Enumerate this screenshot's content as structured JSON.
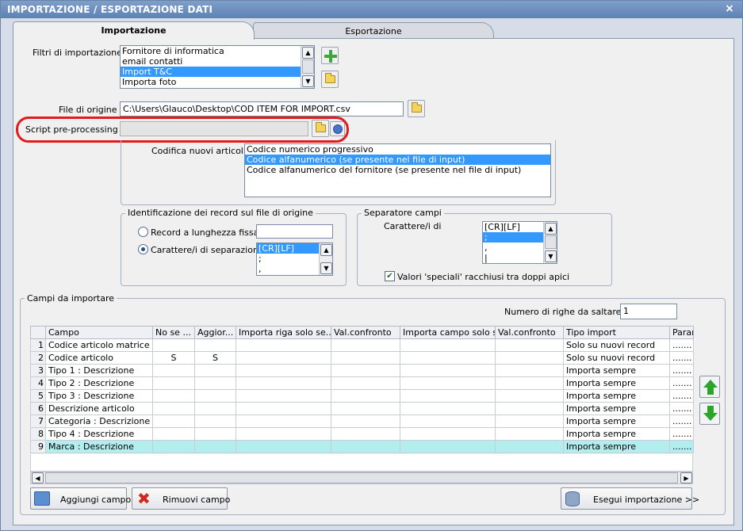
{
  "window": {
    "title": "IMPORTAZIONE / ESPORTAZIONE DATI",
    "close_glyph": "×"
  },
  "tabs": [
    {
      "label": "Importazione"
    },
    {
      "label": "Esportazione"
    }
  ],
  "filters": {
    "label": "Filtri di importazione :",
    "items": [
      "Fornitore di informatica",
      "email contatti",
      "Import T&C",
      "Importa foto"
    ],
    "selected_index": 2
  },
  "source_file": {
    "label": "File di origine :",
    "value": "C:\\Users\\Glauco\\Desktop\\COD ITEM FOR IMPORT.csv"
  },
  "script": {
    "label": "Script pre-processing :",
    "value": ""
  },
  "codifica": {
    "label": "Codifica nuovi articoli :",
    "items": [
      "Codice numerico progressivo",
      "Codice alfanumerico (se presente nel file di input)",
      "Codice alfanumerico del fornitore (se presente nel file di input)"
    ],
    "selected_index": 1
  },
  "identification": {
    "title": "Identificazione dei record sul file di origine",
    "fixed_label": "Record a lunghezza fissa",
    "fixed_value": "",
    "sep_label": "Carattere/i di separazione",
    "sep_items": [
      "[CR][LF]",
      ";",
      ","
    ]
  },
  "separator": {
    "title": "Separatore campi",
    "chars_label": "Carattere/i di",
    "items": [
      "[CR][LF]",
      ";",
      ",",
      "|"
    ],
    "quotes_label": "Valori 'speciali' racchiusi tra doppi apici",
    "quotes_checked": "✔"
  },
  "fields": {
    "title": "Campi da importare",
    "skip_label": "Numero di righe da saltare :",
    "skip_value": "1",
    "columns": [
      "Campo",
      "No se ...",
      "Aggior...",
      "Importa riga solo se...",
      "Val.confronto",
      "Importa campo solo s...",
      "Val.confronto",
      "Tipo import",
      "Paran"
    ],
    "rows": [
      {
        "n": "1",
        "campo": "Codice articolo matrice",
        "no_se": "",
        "aggior": "",
        "tipo": "Solo su nuovi record",
        "param": "......."
      },
      {
        "n": "2",
        "campo": "Codice articolo",
        "no_se": "S",
        "aggior": "S",
        "tipo": "Solo su nuovi record",
        "param": "......."
      },
      {
        "n": "3",
        "campo": "Tipo 1 : Descrizione",
        "no_se": "",
        "aggior": "",
        "tipo": "Importa sempre",
        "param": "......."
      },
      {
        "n": "4",
        "campo": "Tipo 2 : Descrizione",
        "no_se": "",
        "aggior": "",
        "tipo": "Importa sempre",
        "param": "......."
      },
      {
        "n": "5",
        "campo": "Tipo 3 : Descrizione",
        "no_se": "",
        "aggior": "",
        "tipo": "Importa sempre",
        "param": "......."
      },
      {
        "n": "6",
        "campo": "Descrizione articolo",
        "no_se": "",
        "aggior": "",
        "tipo": "Importa sempre",
        "param": "......."
      },
      {
        "n": "7",
        "campo": "Categoria : Descrizione ...",
        "no_se": "",
        "aggior": "",
        "tipo": "Importa sempre",
        "param": "......."
      },
      {
        "n": "8",
        "campo": "Tipo 4 : Descrizione",
        "no_se": "",
        "aggior": "",
        "tipo": "Importa sempre",
        "param": "......."
      },
      {
        "n": "9",
        "campo": "Marca : Descrizione",
        "no_se": "",
        "aggior": "",
        "tipo": "Importa sempre",
        "param": "......."
      }
    ],
    "selected_row": 8
  },
  "buttons": {
    "add": "Aggiungi campo",
    "remove": "Rimuovi campo",
    "run": "Esegui importazione >>"
  },
  "colors": {
    "title_bar": "#5e81b5",
    "selection": "#3399ff",
    "grid_selection": "#b2eeee",
    "highlight_oval": "#e31a1a"
  }
}
